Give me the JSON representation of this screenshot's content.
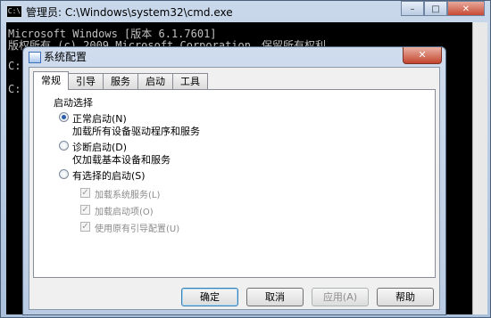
{
  "cmd": {
    "title": "管理员: C:\\Windows\\system32\\cmd.exe",
    "icon_text": "C:\\",
    "lines": [
      "Microsoft Windows [版本 6.1.7601]",
      "版权所有 (c) 2009 Microsoft Corporation。保留所有权利。",
      "C:",
      "C:"
    ],
    "controls": {
      "minimize": "–",
      "maximize": "□",
      "close": "✕"
    }
  },
  "dialog": {
    "title": "系统配置",
    "close_label": "✕",
    "tabs": [
      "常规",
      "引导",
      "服务",
      "启动",
      "工具"
    ],
    "group_label": "启动选择",
    "options": [
      {
        "label": "正常启动(N)",
        "desc": "加载所有设备驱动程序和服务",
        "selected": true
      },
      {
        "label": "诊断启动(D)",
        "desc": "仅加载基本设备和服务",
        "selected": false
      },
      {
        "label": "有选择的启动(S)",
        "desc": "",
        "selected": false
      }
    ],
    "checkboxes": [
      {
        "label": "加载系统服务(L)",
        "checked": true
      },
      {
        "label": "加载启动项(O)",
        "checked": true
      },
      {
        "label": "使用原有引导配置(U)",
        "checked": true
      }
    ],
    "buttons": {
      "ok": "确定",
      "cancel": "取消",
      "apply": "应用(A)",
      "help": "帮助"
    }
  }
}
